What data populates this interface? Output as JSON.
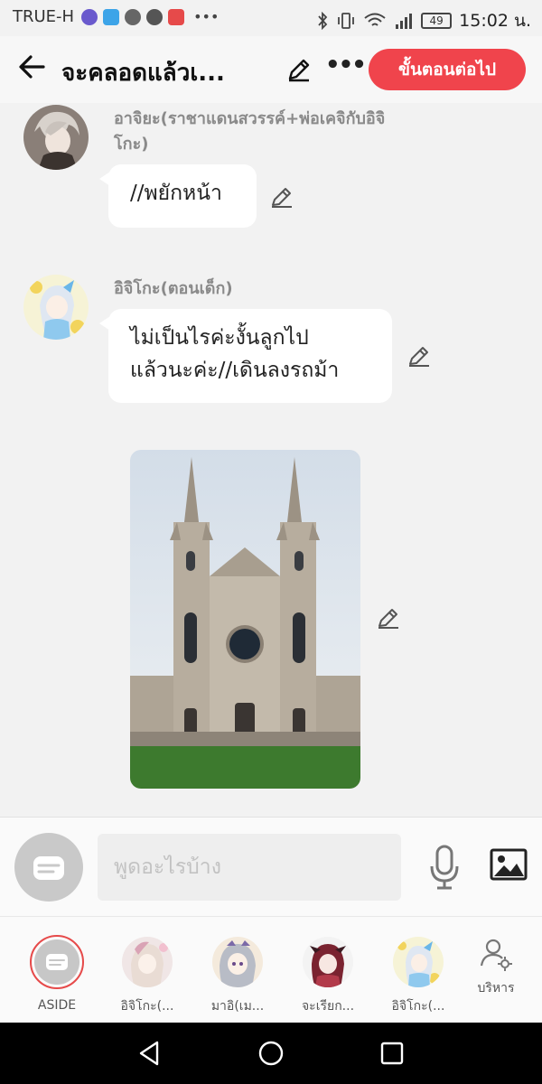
{
  "status_bar": {
    "carrier": "TRUE-H",
    "battery": "49",
    "time": "15:02 น.",
    "app_icon_colors": [
      "#6a5acd",
      "#3da4e8",
      "#666666",
      "#555555",
      "#e64a4a"
    ]
  },
  "header": {
    "title": "จะคลอดแล้วเ...",
    "next_button": "ขั้นตอนต่อไป"
  },
  "messages": [
    {
      "sender": "อาจิยะ(ราชาแดนสวรรค์+พ่อเคจิกับอิจิ",
      "sender_line2": "โกะ)",
      "text": "//พยักหน้า"
    },
    {
      "sender": "อิจิโกะ(ตอนเด็ก)",
      "text_line1": "ไม่เป็นไรค่ะงั้นลูกไป",
      "text_line2": "แล้วนะค่ะ//เดินลงรถม้า"
    }
  ],
  "composer": {
    "placeholder": "พูดอะไรบ้าง"
  },
  "characters": [
    {
      "label": "ASIDE"
    },
    {
      "label": "อิจิโกะ(..."
    },
    {
      "label": "มาอิ(เม..."
    },
    {
      "label": "จะเรียก..."
    },
    {
      "label": "อิจิโกะ(..."
    }
  ],
  "manage_label": "บริหาร",
  "colors": {
    "accent": "#f0444c",
    "bubble": "#ffffff",
    "background": "#f2f2f2"
  }
}
